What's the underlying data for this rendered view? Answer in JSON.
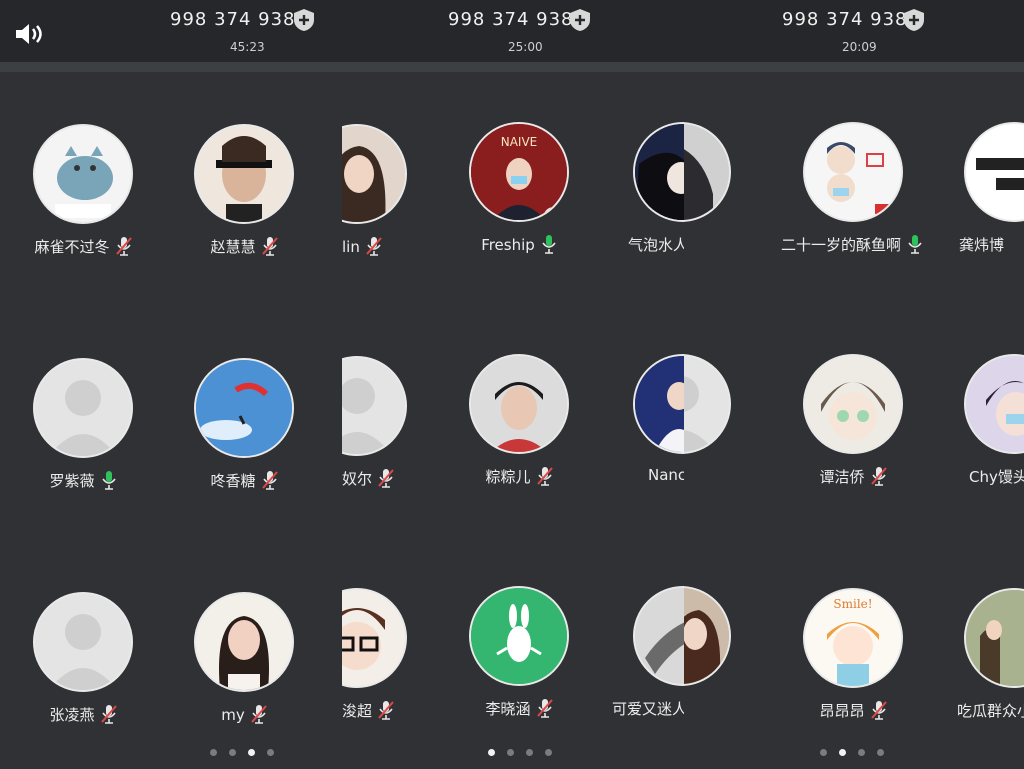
{
  "panels": [
    {
      "meeting_id": "998 374 938",
      "timer": "45:23",
      "page_indicator": {
        "count": 4,
        "active_index": 2
      },
      "participants": [
        {
          "name": "麻雀不过冬",
          "mic": "muted"
        },
        {
          "name": "赵慧慧",
          "mic": "muted"
        },
        {
          "name": "罗紫薇",
          "mic": "speaking"
        },
        {
          "name": "咚香糖",
          "mic": "muted"
        },
        {
          "name": "张凌燕",
          "mic": "muted"
        },
        {
          "name": "my",
          "mic": "muted"
        }
      ]
    },
    {
      "meeting_id": "998 374 938",
      "timer": "25:00",
      "page_indicator": {
        "count": 4,
        "active_index": 0
      },
      "participants": [
        {
          "name": "lin",
          "mic": "muted"
        },
        {
          "name": "Freship",
          "mic": "speaking"
        },
        {
          "name": "奴尔",
          "mic": "muted"
        },
        {
          "name": "粽粽儿",
          "mic": "muted"
        },
        {
          "name": "浚超",
          "mic": "muted"
        },
        {
          "name": "李晓涵",
          "mic": "muted"
        }
      ],
      "partial_right": [
        {
          "name": "气泡水人的反...",
          "mic": "muted"
        },
        {
          "name": "Nancy",
          "mic": "muted"
        },
        {
          "name": "可爱又迷人锦",
          "mic": "muted"
        }
      ]
    },
    {
      "meeting_id": "998 374 938",
      "timer": "20:09",
      "page_indicator": {
        "count": 4,
        "active_index": 1
      },
      "participants": [
        {
          "name": "二十一岁的酥鱼啊",
          "mic": "speaking"
        },
        {
          "name": "龚炜博",
          "mic": "muted"
        },
        {
          "name": "谭洁侨",
          "mic": "muted"
        },
        {
          "name": "Chy馒头",
          "mic": "muted"
        },
        {
          "name": "昂昂昂",
          "mic": "muted"
        },
        {
          "name": "吃瓜群众小",
          "mic": "muted"
        }
      ]
    }
  ],
  "colors": {
    "mic_speaking": "#2fc25b",
    "mic_muted_slash": "#e04848",
    "background": "#2f3134",
    "header": "#25272a"
  }
}
